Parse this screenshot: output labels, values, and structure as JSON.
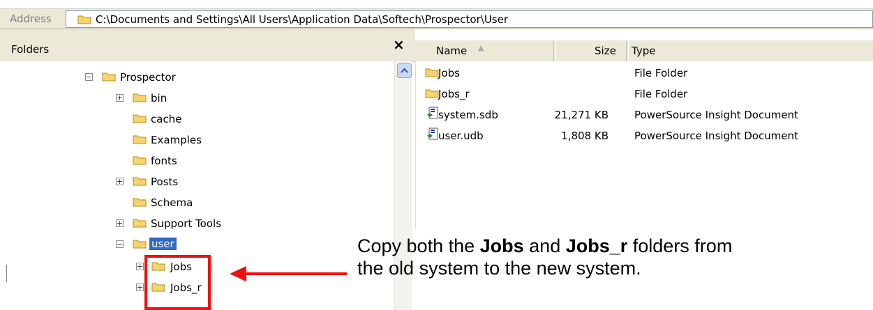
{
  "address_bar": {
    "label": "Address",
    "path": "C:\\Documents and Settings\\All Users\\Application Data\\Softech\\Prospector\\User"
  },
  "folders_panel": {
    "title": "Folders",
    "close_glyph": "×",
    "tree": [
      {
        "label": "Prospector",
        "expander": "−"
      },
      {
        "label": "bin",
        "expander": "+"
      },
      {
        "label": "cache",
        "expander": ""
      },
      {
        "label": "Examples",
        "expander": ""
      },
      {
        "label": "fonts",
        "expander": ""
      },
      {
        "label": "Posts",
        "expander": "+"
      },
      {
        "label": "Schema",
        "expander": ""
      },
      {
        "label": "Support Tools",
        "expander": "+"
      },
      {
        "label": "user",
        "expander": "−",
        "selected": true
      },
      {
        "label": "Jobs",
        "expander": "+"
      },
      {
        "label": "Jobs_r",
        "expander": "+"
      }
    ]
  },
  "file_list": {
    "columns": {
      "name": "Name",
      "size": "Size",
      "type": "Type"
    },
    "sort_glyph": "▲",
    "rows": [
      {
        "name": "Jobs",
        "size": "",
        "type": "File Folder",
        "icon": "folder-icon"
      },
      {
        "name": "Jobs_r",
        "size": "",
        "type": "File Folder",
        "icon": "folder-icon"
      },
      {
        "name": "system.sdb",
        "size": "21,271 KB",
        "type": "PowerSource Insight Document",
        "icon": "document-icon"
      },
      {
        "name": "user.udb",
        "size": "1,808 KB",
        "type": "PowerSource Insight Document",
        "icon": "document-icon"
      }
    ]
  },
  "callout": {
    "part1": "Copy both the ",
    "bold1": "Jobs",
    "part2": " and ",
    "bold2": "Jobs_r",
    "part3": " folders from the old system to the new system."
  },
  "colors": {
    "callout_red": "#ee1111",
    "selection_blue": "#316ac5",
    "folder_yellow": "#f7d46b"
  }
}
